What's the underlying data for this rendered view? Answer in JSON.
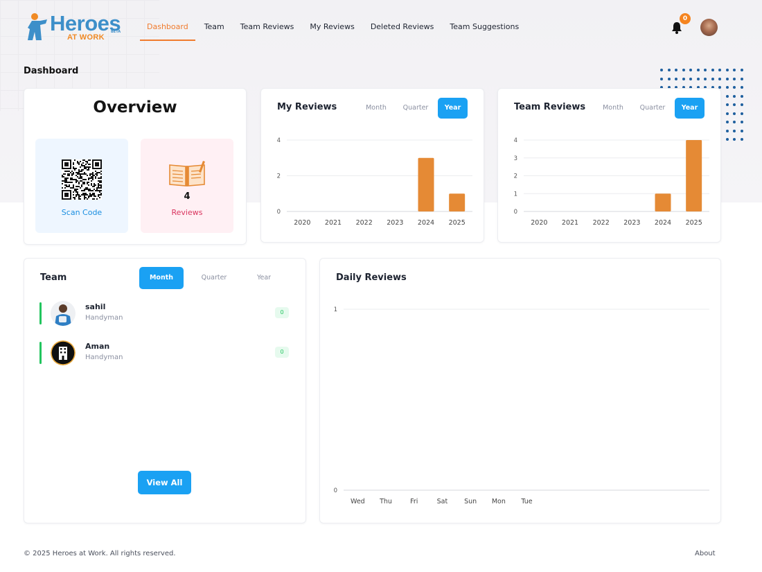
{
  "brand": {
    "name": "Heroes",
    "subtitle": "AT WORK",
    "tag": "BETA",
    "colors": {
      "primary": "#3d8fc9",
      "accent": "#f08a24"
    }
  },
  "nav": {
    "items": [
      {
        "label": "Dashboard",
        "active": true
      },
      {
        "label": "Team",
        "active": false
      },
      {
        "label": "Team Reviews",
        "active": false
      },
      {
        "label": "My Reviews",
        "active": false
      },
      {
        "label": "Deleted Reviews",
        "active": false
      },
      {
        "label": "Team Suggestions",
        "active": false
      }
    ]
  },
  "header": {
    "notification_icon": "bell-icon",
    "notification_count": "0",
    "user_avatar": "user-avatar"
  },
  "page": {
    "title": "Dashboard"
  },
  "overview": {
    "title": "Overview",
    "scan_label": "Scan Code",
    "scan_icon": "qr-code-icon",
    "reviews_count": "4",
    "reviews_label": "Reviews",
    "reviews_icon": "open-book-icon"
  },
  "my_reviews": {
    "title": "My Reviews",
    "filters": [
      "Month",
      "Quarter",
      "Year"
    ],
    "selected_filter": "Year"
  },
  "team_reviews": {
    "title": "Team Reviews",
    "filters": [
      "Month",
      "Quarter",
      "Year"
    ],
    "selected_filter": "Year"
  },
  "team": {
    "title": "Team",
    "filters": [
      "Month",
      "Quarter",
      "Year"
    ],
    "selected_filter": "Month",
    "members": [
      {
        "name": "sahil",
        "role": "Handyman",
        "count": "0"
      },
      {
        "name": "Aman",
        "role": "Handyman",
        "count": "0"
      }
    ],
    "view_all_label": "View All"
  },
  "daily_reviews": {
    "title": "Daily Reviews"
  },
  "footer": {
    "copyright": "© 2025  Heroes at Work. All rights reserved.",
    "about": "About"
  },
  "chart_data": [
    {
      "type": "bar",
      "title": "My Reviews",
      "categories": [
        "2020",
        "2021",
        "2022",
        "2023",
        "2024",
        "2025"
      ],
      "values": [
        0,
        0,
        0,
        0,
        3,
        1
      ],
      "yticks": [
        "0",
        "2",
        "4"
      ],
      "ylim": [
        0,
        4
      ],
      "color": "#e58a35",
      "grid": true
    },
    {
      "type": "bar",
      "title": "Team Reviews",
      "categories": [
        "2020",
        "2021",
        "2022",
        "2023",
        "2024",
        "2025"
      ],
      "values": [
        0,
        0,
        0,
        0,
        1,
        4
      ],
      "yticks": [
        "0",
        "1",
        "2",
        "3",
        "4"
      ],
      "ylim": [
        0,
        4
      ],
      "color": "#e58a35",
      "grid": true
    },
    {
      "type": "bar",
      "title": "Daily Reviews",
      "categories": [
        "Wed",
        "Thu",
        "Fri",
        "Sat",
        "Sun",
        "Mon",
        "Tue"
      ],
      "values": [
        0,
        0,
        0,
        0,
        0,
        0,
        0
      ],
      "yticks": [
        "0",
        "1"
      ],
      "ylim": [
        0,
        1
      ],
      "color": "#e58a35",
      "grid": true
    }
  ]
}
